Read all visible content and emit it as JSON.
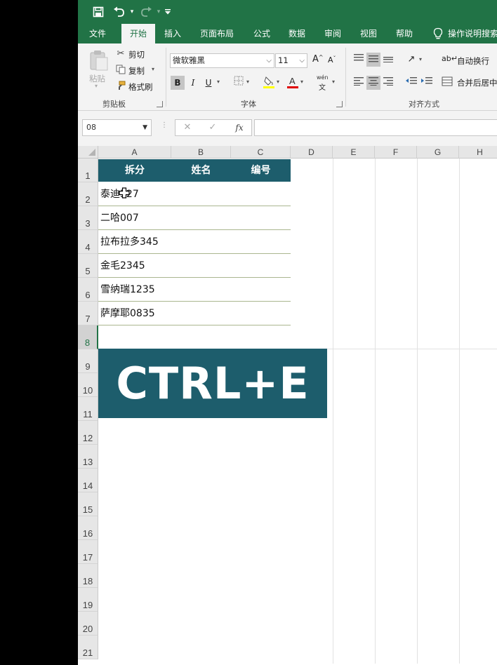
{
  "quick_access": {
    "save_icon": "save-icon",
    "undo_icon": "undo-icon",
    "redo_icon": "redo-icon",
    "customize_icon": "customize-qat-icon"
  },
  "tabs": [
    "文件",
    "开始",
    "插入",
    "页面布局",
    "公式",
    "数据",
    "审阅",
    "视图",
    "帮助"
  ],
  "active_tab": "开始",
  "tell_me": "操作说明搜索",
  "clipboard": {
    "paste": "粘贴",
    "cut": "剪切",
    "copy": "复制",
    "format_painter": "格式刷",
    "group": "剪贴板"
  },
  "font": {
    "name": "微软雅黑",
    "size": "11",
    "group": "字体",
    "bold": "B",
    "italic": "I",
    "underline": "U",
    "grow": "A",
    "shrink": "A",
    "phonetic_top": "wén",
    "phonetic_bottom": "文"
  },
  "alignment": {
    "wrap_text": "自动换行",
    "merge_center": "合并后居中",
    "group": "对齐方式"
  },
  "formula_bar": {
    "name_box": "08",
    "cancel": "✕",
    "enter": "✓",
    "fx": "fx",
    "value": ""
  },
  "columns": [
    "A",
    "B",
    "C",
    "D",
    "E",
    "F",
    "G",
    "H"
  ],
  "rows": [
    "1",
    "2",
    "3",
    "4",
    "5",
    "6",
    "7",
    "8",
    "9",
    "10",
    "11",
    "12",
    "13",
    "14",
    "15",
    "16",
    "17",
    "18",
    "19",
    "20",
    "21"
  ],
  "selected_row": "8",
  "table": {
    "headers": [
      "拆分",
      "姓名",
      "编号"
    ],
    "rows": [
      "泰迪527",
      "二哈007",
      "拉布拉多345",
      "金毛2345",
      "雪纳瑞1235",
      "萨摩耶0835"
    ]
  },
  "banner": {
    "text": "CTRL+E",
    "color": "#1d5d6c"
  },
  "colors": {
    "excel_green": "#217346",
    "header_fill": "#1d5d6c",
    "row_border": "#aab68f"
  }
}
